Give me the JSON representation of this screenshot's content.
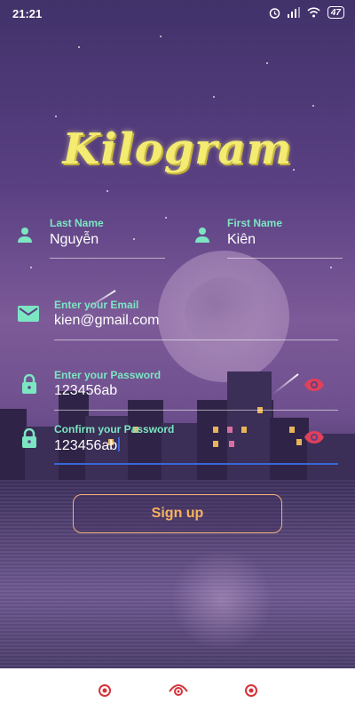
{
  "status_bar": {
    "time": "21:21",
    "battery": "47"
  },
  "app": {
    "logo": "Kilogram"
  },
  "form": {
    "last_name": {
      "label": "Last Name",
      "value": "Nguyễn"
    },
    "first_name": {
      "label": "First Name",
      "value": "Kiên"
    },
    "email": {
      "label": "Enter your Email",
      "value": "kien@gmail.com"
    },
    "password": {
      "label": "Enter your Password",
      "value": "123456ab"
    },
    "confirm_password": {
      "label": "Confirm your Password",
      "value": "123456ab"
    },
    "signup_label": "Sign up"
  },
  "icons": {
    "last_name": "person-icon",
    "first_name": "person-icon",
    "email": "mail-icon",
    "password": "lock-icon",
    "confirm_password": "lock-icon",
    "password_visibility": "eye-icon",
    "confirm_visibility": "eye-icon"
  },
  "colors": {
    "label": "#7ce6c3",
    "signup_text": "#f7b25e",
    "eye": "#e0405a",
    "logo": "#f3ec70"
  }
}
